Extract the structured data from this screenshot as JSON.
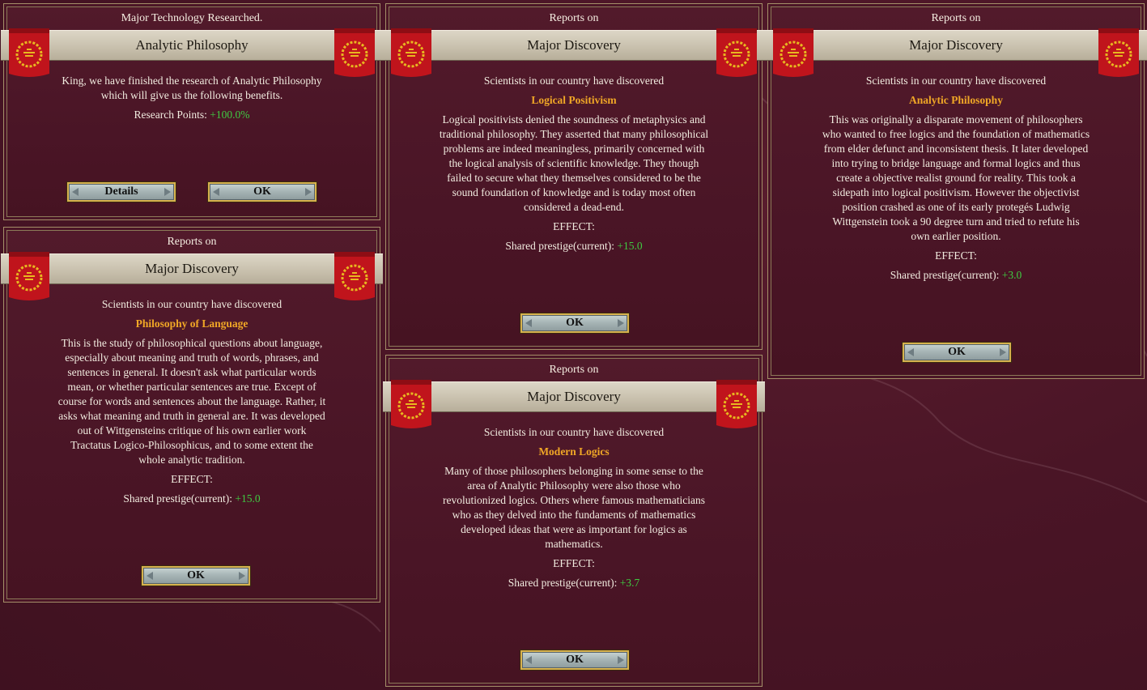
{
  "colors": {
    "panel_bg": "#4b1526",
    "gold_text": "#f0a726",
    "green_text": "#3fcc42",
    "title_bar": "#ccc4b2"
  },
  "tech_panel": {
    "kicker": "Major Technology Researched.",
    "title": "Analytic Philosophy",
    "message_lines": [
      "King, we have finished the research of Analytic Philosophy",
      "which will give us the following benefits."
    ],
    "research_label": "Research Points:",
    "research_value": "+100.0%",
    "details_button": "Details",
    "ok_button": "OK"
  },
  "logical_positivism_panel": {
    "kicker": "Reports on",
    "title": "Major Discovery",
    "intro": "Scientists in our country have discovered",
    "discovery": "Logical Positivism",
    "description_lines": [
      "Logical positivists denied the soundness of metaphysics and",
      "traditional philosophy. They asserted that many philosophical",
      "problems are indeed meaningless, primarily concerned with",
      "the logical analysis of scientific knowledge. They though",
      "failed to secure what they themselves considered to be the",
      "sound foundation of knowledge and is today most often",
      "considered a dead-end."
    ],
    "effect_label": "EFFECT:",
    "prestige_label": "Shared prestige(current):",
    "prestige_value": "+15.0",
    "ok_button": "OK"
  },
  "analytic_philosophy_panel": {
    "kicker": "Reports on",
    "title": "Major Discovery",
    "intro": "Scientists in our country have discovered",
    "discovery": "Analytic Philosophy",
    "description_lines": [
      "This was originally a disparate movement of philosophers",
      "who wanted to free logics and the foundation of mathematics",
      "from elder defunct and inconsistent thesis. It later developed",
      "into trying to bridge language and formal logics and thus",
      "create a objective realist ground for reality. This took a",
      "sidepath into logical positivism. However the objectivist",
      "position crashed as one of its early protegés Ludwig",
      "Wittgenstein took a 90 degree turn and tried to refute his",
      "own earlier position."
    ],
    "effect_label": "EFFECT:",
    "prestige_label": "Shared prestige(current):",
    "prestige_value": "+3.0",
    "ok_button": "OK"
  },
  "philosophy_of_language_panel": {
    "kicker": "Reports on",
    "title": "Major Discovery",
    "intro": "Scientists in our country have discovered",
    "discovery": "Philosophy of Language",
    "description_lines": [
      "This is the study of philosophical questions about language,",
      "especially about meaning and truth of words, phrases, and",
      "sentences in general. It doesn't ask what particular words",
      "mean, or whether particular sentences are true. Except of",
      "course for words and sentences about the language. Rather, it",
      "asks what meaning and truth in general are. It was developed",
      "out of Wittgensteins critique of his own earlier work",
      "Tractatus Logico-Philosophicus, and to some extent the",
      "whole analytic tradition."
    ],
    "effect_label": "EFFECT:",
    "prestige_label": "Shared prestige(current):",
    "prestige_value": "+15.0",
    "ok_button": "OK"
  },
  "modern_logics_panel": {
    "kicker": "Reports on",
    "title": "Major Discovery",
    "intro": "Scientists in our country have discovered",
    "discovery": "Modern Logics",
    "description_lines": [
      "Many of those philosophers belonging in some sense to the",
      "area of Analytic Philosophy were also those who",
      "revolutionized logics. Others where famous mathematicians",
      "who as they delved into the fundaments of mathematics",
      "developed ideas that were as important for logics as",
      "mathematics."
    ],
    "effect_label": "EFFECT:",
    "prestige_label": "Shared prestige(current):",
    "prestige_value": "+3.7",
    "ok_button": "OK"
  }
}
